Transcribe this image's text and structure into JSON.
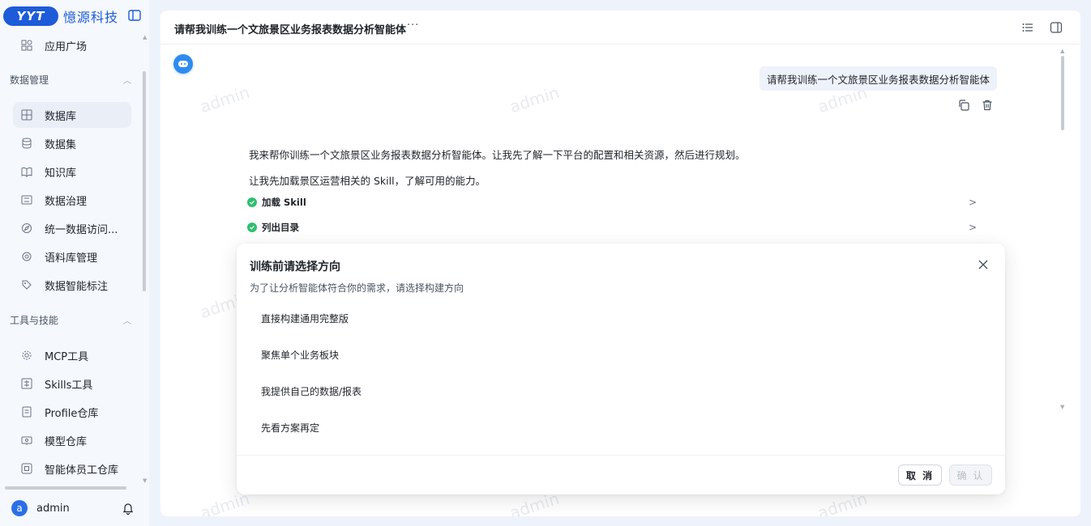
{
  "brand": {
    "logo_text": "YYT",
    "name": "憶源科技"
  },
  "sidebar": {
    "top_item": "应用广场",
    "groups": [
      {
        "title": "数据管理",
        "items": [
          "数据库",
          "数据集",
          "知识库",
          "数据治理",
          "统一数据访问...",
          "语料库管理",
          "数据智能标注"
        ]
      },
      {
        "title": "工具与技能",
        "items": [
          "MCP工具",
          "Skills工具",
          "Profile仓库",
          "模型仓库",
          "智能体员工仓库"
        ]
      }
    ],
    "user": {
      "avatar_letter": "a",
      "name": "admin"
    }
  },
  "chat": {
    "title": "请帮我训练一个文旅景区业务报表数据分析智能体",
    "more": "···",
    "watermark": "admin",
    "user_message": "请帮我训练一个文旅景区业务报表数据分析智能体",
    "reply_lines": [
      "我来帮你训练一个文旅景区业务报表数据分析智能体。让我先了解一下平台的配置和相关资源，然后进行规划。",
      "让我先加载景区运营相关的 Skill，了解可用的能力。"
    ],
    "steps": [
      {
        "label": "加载 Skill",
        "status": "done"
      },
      {
        "label": "列出目录",
        "status": "done"
      }
    ]
  },
  "dialog": {
    "title": "训练前请选择方向",
    "subtitle": "为了让分析智能体符合你的需求，请选择构建方向",
    "options": [
      "直接构建通用完整版",
      "聚焦单个业务板块",
      "我提供自己的数据/报表",
      "先看方案再定"
    ],
    "cancel_label": "取 消",
    "confirm_label": "确 认"
  },
  "colors": {
    "brand": "#1d5bd8",
    "success": "#2fbf71",
    "accent": "#2f8bf0"
  }
}
